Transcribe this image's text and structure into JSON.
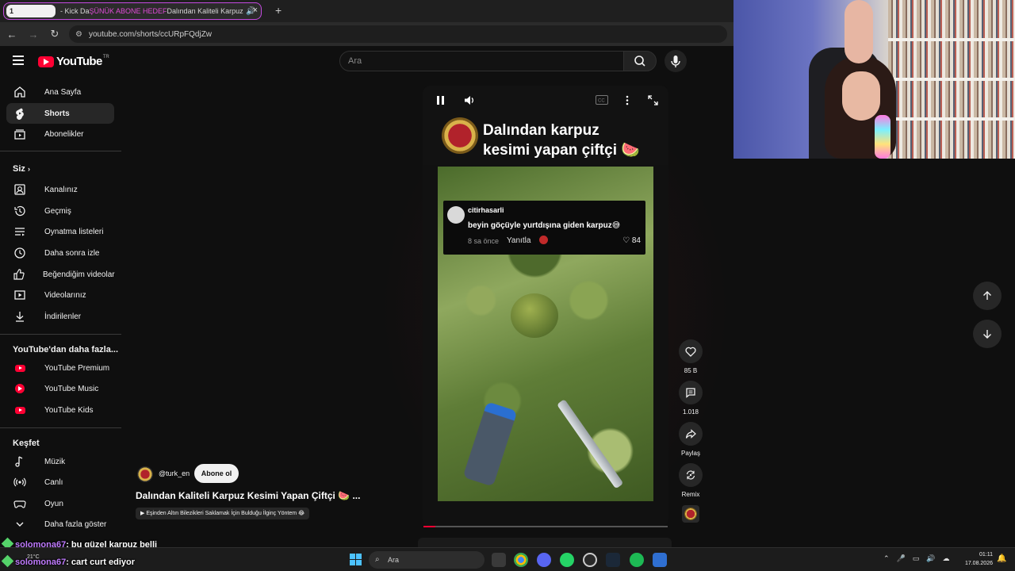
{
  "browser": {
    "tab_number": "1",
    "tab_title_prefix": "- Kick Da",
    "tab_title_overlay": "ŞÜNÜK ABONE HEDEF",
    "tab_title_suffix": "Dalından Kaliteli Karpuz Ke",
    "tab_new": "+",
    "tab_close": "×",
    "url": "youtube.com/shorts/ccURpFQdjZw"
  },
  "header": {
    "logo_text": "YouTube",
    "region": "TR",
    "search_placeholder": "Ara"
  },
  "sidebar": {
    "main": [
      {
        "label": "Ana Sayfa",
        "icon": "home-icon"
      },
      {
        "label": "Shorts",
        "icon": "shorts-icon",
        "active": true
      },
      {
        "label": "Abonelikler",
        "icon": "subscriptions-icon"
      }
    ],
    "you_heading": "Siz",
    "you_items": [
      {
        "label": "Kanalınız",
        "icon": "channel-icon"
      },
      {
        "label": "Geçmiş",
        "icon": "history-icon"
      },
      {
        "label": "Oynatma listeleri",
        "icon": "playlist-icon"
      },
      {
        "label": "Daha sonra izle",
        "icon": "watch-later-icon"
      },
      {
        "label": "Beğendiğim videolar",
        "icon": "like-icon"
      },
      {
        "label": "Videolarınız",
        "icon": "videos-icon"
      },
      {
        "label": "İndirilenler",
        "icon": "download-icon"
      }
    ],
    "more_heading": "YouTube'dan daha fazla...",
    "more_items": [
      {
        "label": "YouTube Premium",
        "icon": "youtube-premium-icon"
      },
      {
        "label": "YouTube Music",
        "icon": "youtube-music-icon"
      },
      {
        "label": "YouTube Kids",
        "icon": "youtube-kids-icon"
      }
    ],
    "explore_heading": "Keşfet",
    "explore_items": [
      {
        "label": "Müzik",
        "icon": "music-icon"
      },
      {
        "label": "Canlı",
        "icon": "live-icon"
      },
      {
        "label": "Oyun",
        "icon": "gaming-icon"
      },
      {
        "label": "Daha fazla göster",
        "icon": "chevron-down-icon"
      }
    ]
  },
  "short": {
    "title_line1": "Dalından karpuz",
    "title_line2": "kesimi yapan çiftçi 🍉",
    "comment": {
      "user": "citirhasarli",
      "text": "beyin göçüyle yurtdışına giden karpuz😅",
      "time": "8 sa önce",
      "reply": "Yanıtla",
      "likes": "♡ 84"
    },
    "progress": 0.05
  },
  "actions": {
    "likes": "85 B",
    "comments": "1.018",
    "share": "Paylaş",
    "remix": "Remix"
  },
  "channel": {
    "handle": "@turk_en",
    "subscribe": "Abone ol",
    "video_title": "Dalından Kaliteli Karpuz Kesimi Yapan Çiftçi 🍉 ...",
    "related": "▶ Eşinden Altın Bilezikleri Saklamak İçin Bulduğu İlginç Yöntem 😂"
  },
  "chat": [
    {
      "user": "solomona67",
      "message": ": bu güzel karpuz belli"
    },
    {
      "user": "solomona67",
      "message": ": cart curt ediyor"
    }
  ],
  "taskbar": {
    "weather": "21°C",
    "search": "Ara",
    "time": "01:11",
    "date": "17.08.2026"
  },
  "colors": {
    "accent": "#ff0033",
    "chat_user": "#c07bff"
  }
}
